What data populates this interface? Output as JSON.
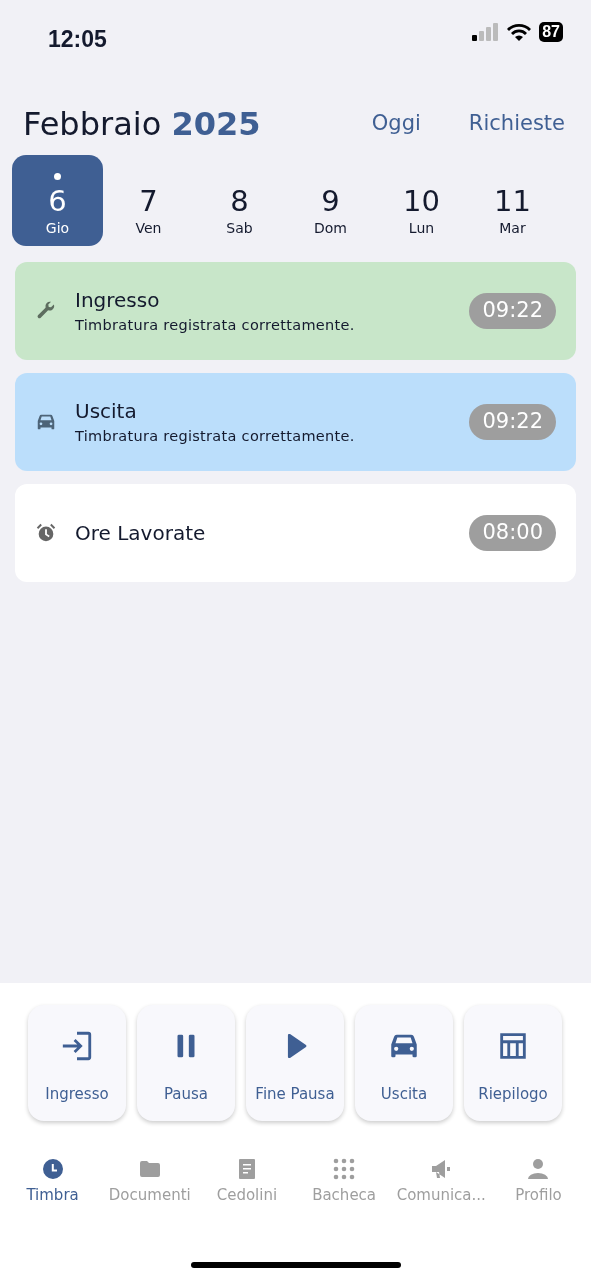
{
  "status_bar": {
    "time": "12:05",
    "battery": "87"
  },
  "header": {
    "month": "Febbraio",
    "year": "2025",
    "links": [
      "Oggi",
      "Richieste"
    ]
  },
  "days": [
    {
      "number": "6",
      "weekday": "Gio",
      "selected": true,
      "marked": true
    },
    {
      "number": "7",
      "weekday": "Ven",
      "selected": false,
      "marked": false
    },
    {
      "number": "8",
      "weekday": "Sab",
      "selected": false,
      "marked": false
    },
    {
      "number": "9",
      "weekday": "Dom",
      "selected": false,
      "marked": false
    },
    {
      "number": "10",
      "weekday": "Lun",
      "selected": false,
      "marked": false
    },
    {
      "number": "11",
      "weekday": "Mar",
      "selected": false,
      "marked": false
    }
  ],
  "entries": [
    {
      "kind": "wrench",
      "title": "Ingresso",
      "subtitle": "Timbratura registrata correttamente.",
      "time": "09:22",
      "color": "#c8e6c9"
    },
    {
      "kind": "car",
      "title": "Uscita",
      "subtitle": "Timbratura registrata correttamente.",
      "time": "09:22",
      "color": "#bbdefb"
    },
    {
      "kind": "alarm",
      "title": "Ore Lavorate",
      "time": "08:00",
      "color": "#ffffff"
    }
  ],
  "actions": [
    {
      "kind": "login",
      "label": "Ingresso"
    },
    {
      "kind": "pause",
      "label": "Pausa"
    },
    {
      "kind": "play",
      "label": "Fine Pausa"
    },
    {
      "kind": "car",
      "label": "Uscita"
    },
    {
      "kind": "table",
      "label": "Riepilogo"
    }
  ],
  "nav": [
    {
      "kind": "clock",
      "label": "Timbra",
      "selected": true
    },
    {
      "kind": "folder",
      "label": "Documenti",
      "selected": false
    },
    {
      "kind": "doc",
      "label": "Cedolini",
      "selected": false
    },
    {
      "kind": "grid",
      "label": "Bacheca",
      "selected": false
    },
    {
      "kind": "megaphone",
      "label": "Comunica...",
      "selected": false
    },
    {
      "kind": "person",
      "label": "Profilo",
      "selected": false
    }
  ]
}
